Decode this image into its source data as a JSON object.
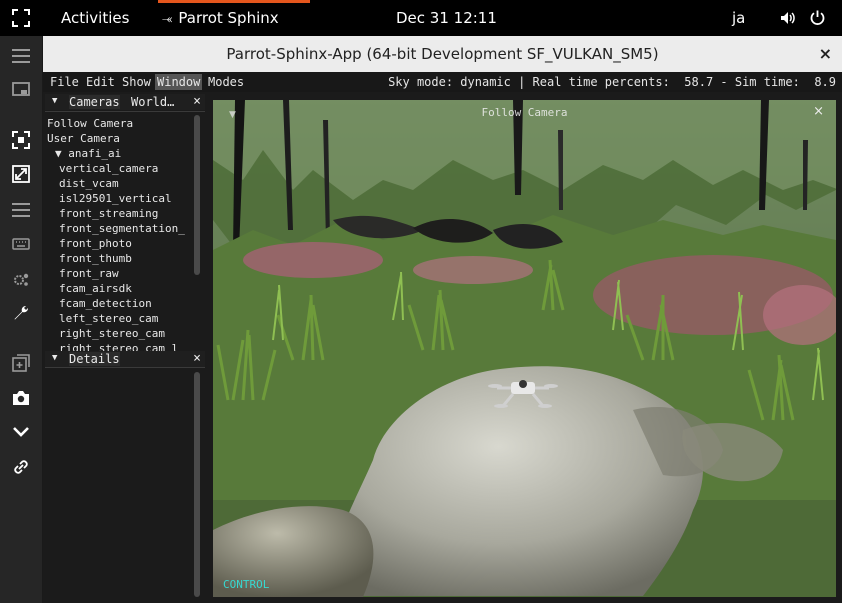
{
  "topbar": {
    "activities": "Activities",
    "app_menu": "Parrot Sphinx",
    "app_icon": "parrot-sphinx-icon",
    "clock": "Dec 31  12:11",
    "input_method": "ja",
    "volume_icon": "volume-icon",
    "power_icon": "power-icon",
    "accent_color": "#e5561d"
  },
  "dock": {
    "items": [
      "fullscreen-icon",
      "menu-icon",
      "window-icon",
      "focus-icon",
      "expand-icon",
      "list-icon",
      "keyboard-icon",
      "settings-icon",
      "wrench-icon",
      "add-window-icon",
      "camera-icon",
      "chevron-down-icon",
      "link-icon"
    ]
  },
  "window": {
    "title": "Parrot-Sphinx-App (64-bit Development SF_VULKAN_SM5)",
    "close": "×"
  },
  "menubar": {
    "items": [
      "File",
      "Edit",
      "Show",
      "Window",
      "Modes"
    ],
    "active_item": "Window",
    "status": "Sky mode: dynamic | Real time percents:  58.7 - Sim time:  8.9"
  },
  "cameras_panel": {
    "tabs": [
      "Cameras",
      "World…"
    ],
    "close": "×",
    "items": [
      "Follow Camera",
      "User Camera",
      "▼ anafi_ai",
      "vertical_camera",
      "dist_vcam",
      "isl29501_vertical",
      "front_streaming",
      "front_segmentation_",
      "front_photo",
      "front_thumb",
      "front_raw",
      "fcam_airsdk",
      "fcam_detection",
      "left_stereo_cam",
      "right_stereo_cam",
      "right_stereo_cam_l"
    ]
  },
  "details_panel": {
    "tab": "Details",
    "close": "×"
  },
  "viewport": {
    "title": "Follow Camera",
    "close": "×",
    "footer": "CONTROL",
    "footer_color": "#37d8d0"
  }
}
